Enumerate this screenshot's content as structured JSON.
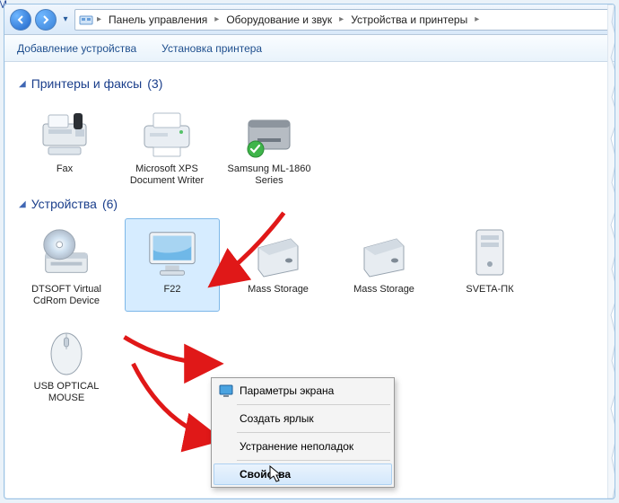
{
  "corner_text": "М",
  "breadcrumbs": {
    "items": [
      "Панель управления",
      "Оборудование и звук",
      "Устройства и принтеры"
    ]
  },
  "toolbar": {
    "add_device": "Добавление устройства",
    "install_printer": "Установка принтера"
  },
  "groups": {
    "printers": {
      "title": "Принтеры и факсы",
      "count": "(3)"
    },
    "devices": {
      "title": "Устройства",
      "count": "(6)"
    }
  },
  "printers": [
    {
      "label": "Fax"
    },
    {
      "label": "Microsoft XPS Document Writer"
    },
    {
      "label": "Samsung ML-1860 Series"
    }
  ],
  "devices": [
    {
      "label": "DTSOFT Virtual CdRom Device"
    },
    {
      "label": "F22",
      "selected": true
    },
    {
      "label": "Mass Storage"
    },
    {
      "label": "Mass Storage"
    },
    {
      "label": "SVETA-ПК"
    },
    {
      "label": "USB OPTICAL MOUSE"
    }
  ],
  "context_menu": {
    "display_settings": "Параметры экрана",
    "create_shortcut": "Создать ярлык",
    "troubleshoot": "Устранение неполадок",
    "properties": "Свойства"
  }
}
